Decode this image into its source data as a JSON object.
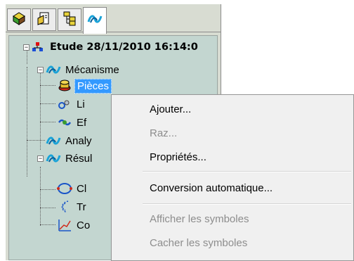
{
  "tabs": [
    {
      "icon": "3d-object-icon"
    },
    {
      "icon": "document-properties-icon"
    },
    {
      "icon": "hierarchy-icon"
    },
    {
      "icon": "mechanism-icon",
      "active": true
    }
  ],
  "tree": {
    "root": {
      "label": "Etude 28/11/2010 16:14:0"
    },
    "mecanisme": {
      "label": "Mécanisme"
    },
    "pieces": {
      "label": "Pièces"
    },
    "liaisons": {
      "label": "Li"
    },
    "efforts": {
      "label": "Ef"
    },
    "analyse": {
      "label": "Analy"
    },
    "resultats": {
      "label": "Résul"
    },
    "r1": {
      "label": "Cl"
    },
    "r2": {
      "label": "Tr"
    },
    "r3": {
      "label": "Co"
    }
  },
  "context_menu": {
    "items": [
      {
        "label": "Ajouter...",
        "enabled": true
      },
      {
        "label": "Raz...",
        "enabled": false
      },
      {
        "label": "Propriétés...",
        "enabled": true
      },
      {
        "label": "Conversion automatique...",
        "enabled": true
      },
      {
        "label": "Afficher les symboles",
        "enabled": false
      },
      {
        "label": "Cacher les symboles",
        "enabled": false
      }
    ]
  },
  "colors": {
    "tree_bg": "#c3d6d0",
    "selection": "#3399ff",
    "menu_bg": "#f0f0f0"
  }
}
